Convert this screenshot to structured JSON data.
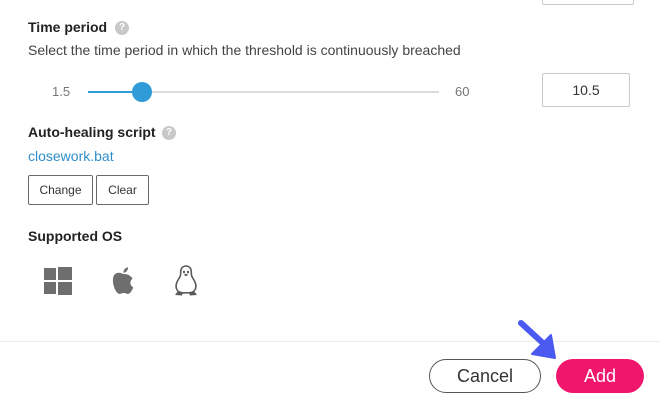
{
  "time_period": {
    "title": "Time period",
    "help_glyph": "?",
    "description": "Select the time period in which the threshold is continuously breached",
    "slider": {
      "min_label": "1.5",
      "max_label": "60",
      "min": 1.5,
      "max": 60,
      "value": 10.5
    },
    "value": "10.5"
  },
  "auto_healing": {
    "title": "Auto-healing script",
    "help_glyph": "?",
    "script_name": "closework.bat",
    "change_label": "Change",
    "clear_label": "Clear"
  },
  "supported_os": {
    "title": "Supported OS",
    "icons": [
      "windows-icon",
      "apple-icon",
      "linux-icon"
    ]
  },
  "footer": {
    "cancel_label": "Cancel",
    "add_label": "Add"
  },
  "colors": {
    "accent": "#2f9bd7",
    "primary_button": "#f0166b",
    "link": "#2f8fc9",
    "annotation_arrow": "#4a5af0"
  }
}
